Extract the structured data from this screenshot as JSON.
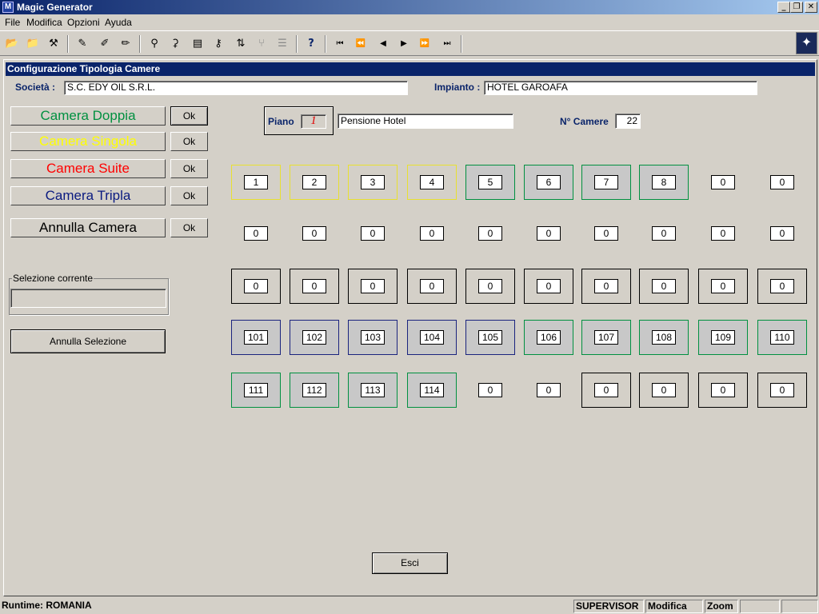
{
  "window": {
    "title": "Magic Generator"
  },
  "menu": [
    "File",
    "Modifica",
    "Opzioni",
    "Ayuda"
  ],
  "child_title": "Configurazione Tipologia Camere",
  "societa": {
    "label": "Società :",
    "value": "S.C. EDY OIL S.R.L."
  },
  "impianto": {
    "label": "Impianto :",
    "value": "HOTEL GAROAFA"
  },
  "types": [
    {
      "label": "Camera Doppia",
      "color": "#009040",
      "ok": "Ok"
    },
    {
      "label": "Camera Singola",
      "color": "#ffff00",
      "ok": "Ok"
    },
    {
      "label": "Camera Suite",
      "color": "#ff0000",
      "ok": "Ok"
    },
    {
      "label": "Camera Tripla",
      "color": "#0a1a80",
      "ok": "Ok"
    },
    {
      "label": "Annulla Camera",
      "color": "#000000",
      "ok": "Ok"
    }
  ],
  "piano": {
    "label": "Piano",
    "value": "1",
    "name": "Pensione Hotel"
  },
  "camere": {
    "label": "N° Camere",
    "value": "22"
  },
  "selezione": {
    "label": "Selezione corrente",
    "value": ""
  },
  "annulla_selezione": "Annulla Selezione",
  "esci": "Esci",
  "rooms": [
    [
      {
        "n": "1",
        "t": "singola"
      },
      {
        "n": "2",
        "t": "singola"
      },
      {
        "n": "3",
        "t": "singola"
      },
      {
        "n": "4",
        "t": "singola"
      },
      {
        "n": "5",
        "t": "doppia"
      },
      {
        "n": "6",
        "t": "doppia"
      },
      {
        "n": "7",
        "t": "doppia"
      },
      {
        "n": "8",
        "t": "doppia"
      },
      {
        "n": "0",
        "t": "empty"
      },
      {
        "n": "0",
        "t": "empty"
      }
    ],
    [
      {
        "n": "0",
        "t": "empty"
      },
      {
        "n": "0",
        "t": "empty"
      },
      {
        "n": "0",
        "t": "empty"
      },
      {
        "n": "0",
        "t": "empty"
      },
      {
        "n": "0",
        "t": "empty"
      },
      {
        "n": "0",
        "t": "empty"
      },
      {
        "n": "0",
        "t": "empty"
      },
      {
        "n": "0",
        "t": "empty"
      },
      {
        "n": "0",
        "t": "empty"
      },
      {
        "n": "0",
        "t": "empty"
      }
    ],
    [
      {
        "n": "0",
        "t": "annulla"
      },
      {
        "n": "0",
        "t": "annulla"
      },
      {
        "n": "0",
        "t": "annulla"
      },
      {
        "n": "0",
        "t": "annulla"
      },
      {
        "n": "0",
        "t": "annulla"
      },
      {
        "n": "0",
        "t": "annulla"
      },
      {
        "n": "0",
        "t": "annulla"
      },
      {
        "n": "0",
        "t": "annulla"
      },
      {
        "n": "0",
        "t": "annulla"
      },
      {
        "n": "0",
        "t": "annulla"
      }
    ],
    [
      {
        "n": "101",
        "t": "tripla"
      },
      {
        "n": "102",
        "t": "tripla"
      },
      {
        "n": "103",
        "t": "tripla"
      },
      {
        "n": "104",
        "t": "tripla"
      },
      {
        "n": "105",
        "t": "tripla"
      },
      {
        "n": "106",
        "t": "doppia"
      },
      {
        "n": "107",
        "t": "doppia"
      },
      {
        "n": "108",
        "t": "doppia"
      },
      {
        "n": "109",
        "t": "doppia"
      },
      {
        "n": "110",
        "t": "doppia"
      }
    ],
    [
      {
        "n": "111",
        "t": "doppia"
      },
      {
        "n": "112",
        "t": "doppia"
      },
      {
        "n": "113",
        "t": "doppia"
      },
      {
        "n": "114",
        "t": "doppia"
      },
      {
        "n": "0",
        "t": "empty"
      },
      {
        "n": "0",
        "t": "empty"
      },
      {
        "n": "0",
        "t": "annulla"
      },
      {
        "n": "0",
        "t": "annulla"
      },
      {
        "n": "0",
        "t": "annulla"
      },
      {
        "n": "0",
        "t": "annulla"
      }
    ]
  ],
  "status": {
    "runtime": "Runtime: ROMANIA",
    "user": "SUPERVISOR",
    "mode": "Modifica",
    "zoom": "Zoom"
  },
  "toolbar_icons": [
    "open-folder-icon",
    "open-folder-arrow-icon",
    "tools-icon",
    "pencil-icon",
    "pencil-plus-icon",
    "pencil-alt-icon",
    "binoculars-icon",
    "binoculars-alt-icon",
    "note-icon",
    "key-icon",
    "sort-az-icon",
    "branch-icon",
    "list-icon",
    "help-icon",
    "first-record-icon",
    "prev-page-icon",
    "prev-record-icon",
    "next-record-icon",
    "next-page-icon",
    "last-record-icon"
  ]
}
